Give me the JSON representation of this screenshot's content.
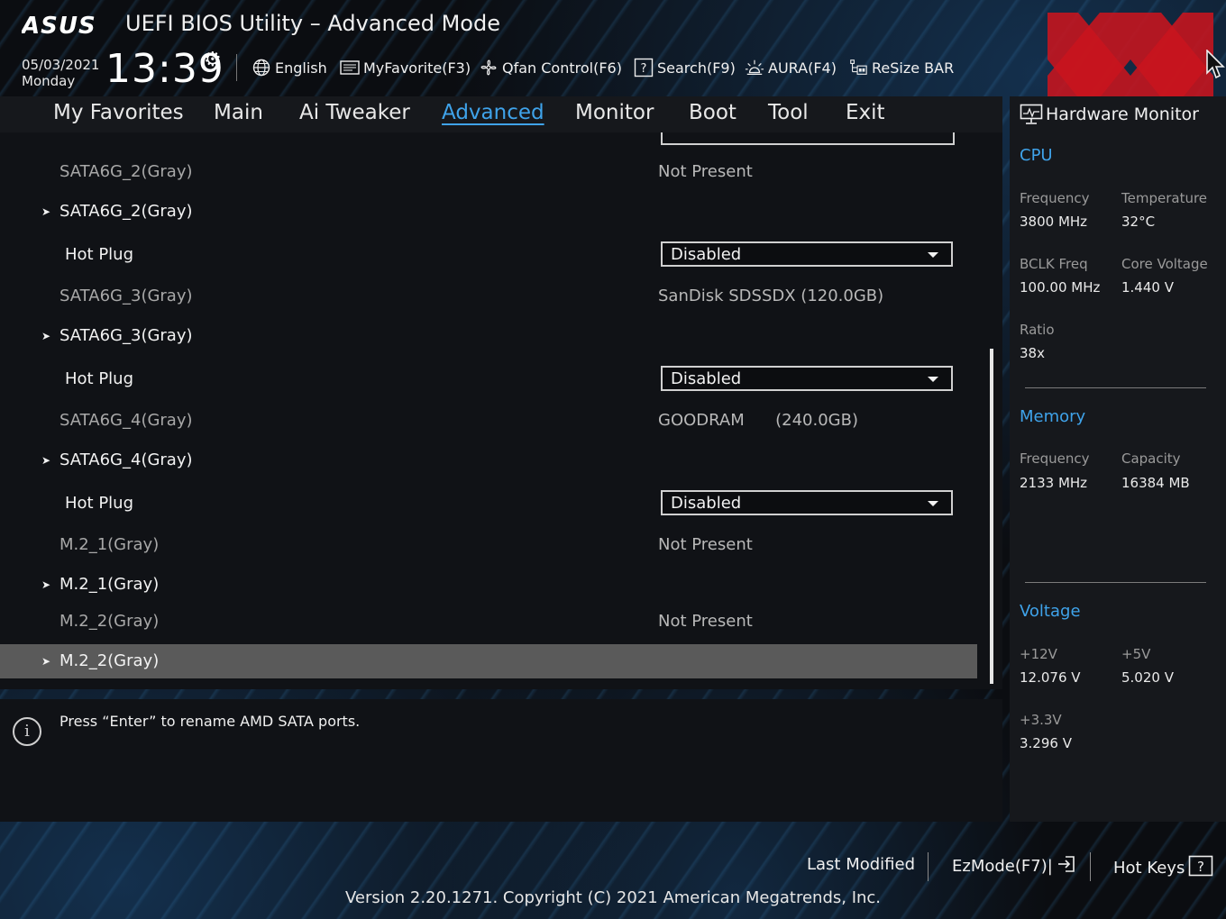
{
  "header": {
    "logo_text": "ASUS",
    "title": "UEFI BIOS Utility – Advanced Mode",
    "date": "05/03/2021",
    "weekday": "Monday",
    "time": "13:39",
    "buttons": [
      {
        "label": "English",
        "icon": "globe-icon"
      },
      {
        "label": "MyFavorite(F3)",
        "icon": "favorite-list-icon"
      },
      {
        "label": "Qfan Control(F6)",
        "icon": "fan-icon"
      },
      {
        "label": "Search(F9)",
        "icon": "question-box-icon"
      },
      {
        "label": "AURA(F4)",
        "icon": "aura-light-icon"
      },
      {
        "label": "ReSize BAR",
        "icon": "resize-bar-icon"
      }
    ]
  },
  "tabs": [
    "My Favorites",
    "Main",
    "Ai Tweaker",
    "Advanced",
    "Monitor",
    "Boot",
    "Tool",
    "Exit"
  ],
  "active_tab": "Advanced",
  "settings": {
    "rows": [
      {
        "type": "info",
        "label": "SATA6G_2(Gray)",
        "value": "Not Present"
      },
      {
        "type": "submenu",
        "label": "SATA6G_2(Gray)"
      },
      {
        "type": "dropdown",
        "label": "Hot Plug",
        "value": "Disabled"
      },
      {
        "type": "info",
        "label": "SATA6G_3(Gray)",
        "value": "SanDisk SDSSDX (120.0GB)"
      },
      {
        "type": "submenu",
        "label": "SATA6G_3(Gray)"
      },
      {
        "type": "dropdown",
        "label": "Hot Plug",
        "value": "Disabled"
      },
      {
        "type": "info",
        "label": "SATA6G_4(Gray)",
        "value": "GOODRAM      (240.0GB)"
      },
      {
        "type": "submenu",
        "label": "SATA6G_4(Gray)"
      },
      {
        "type": "dropdown",
        "label": "Hot Plug",
        "value": "Disabled"
      },
      {
        "type": "info",
        "label": "M.2_1(Gray)",
        "value": "Not Present"
      },
      {
        "type": "submenu",
        "label": "M.2_1(Gray)"
      },
      {
        "type": "info",
        "label": "M.2_2(Gray)",
        "value": "Not Present"
      },
      {
        "type": "submenu",
        "label": "M.2_2(Gray)",
        "selected": true
      }
    ]
  },
  "info": {
    "text": "Press “Enter” to rename AMD SATA ports."
  },
  "hardware_monitor": {
    "title": "Hardware Monitor",
    "cpu": {
      "title": "CPU",
      "frequency_label": "Frequency",
      "frequency": "3800 MHz",
      "temperature_label": "Temperature",
      "temperature": "32°C",
      "bclk_label": "BCLK Freq",
      "bclk": "100.00 MHz",
      "core_voltage_label": "Core Voltage",
      "core_voltage": "1.440 V",
      "ratio_label": "Ratio",
      "ratio": "38x"
    },
    "memory": {
      "title": "Memory",
      "frequency_label": "Frequency",
      "frequency": "2133 MHz",
      "capacity_label": "Capacity",
      "capacity": "16384 MB"
    },
    "voltage": {
      "title": "Voltage",
      "v12_label": "+12V",
      "v12": "12.076 V",
      "v5_label": "+5V",
      "v5": "5.020 V",
      "v33_label": "+3.3V",
      "v33": "3.296 V"
    }
  },
  "footer": {
    "last_modified": "Last Modified",
    "ezmode": "EzMode(F7)|",
    "hotkeys": "Hot Keys",
    "version": "Version 2.20.1271. Copyright (C) 2021 American Megatrends, Inc."
  },
  "colors": {
    "accent": "#3fa3ea",
    "selected_row": "#5a5a5a",
    "watermark": "#c8141e"
  }
}
